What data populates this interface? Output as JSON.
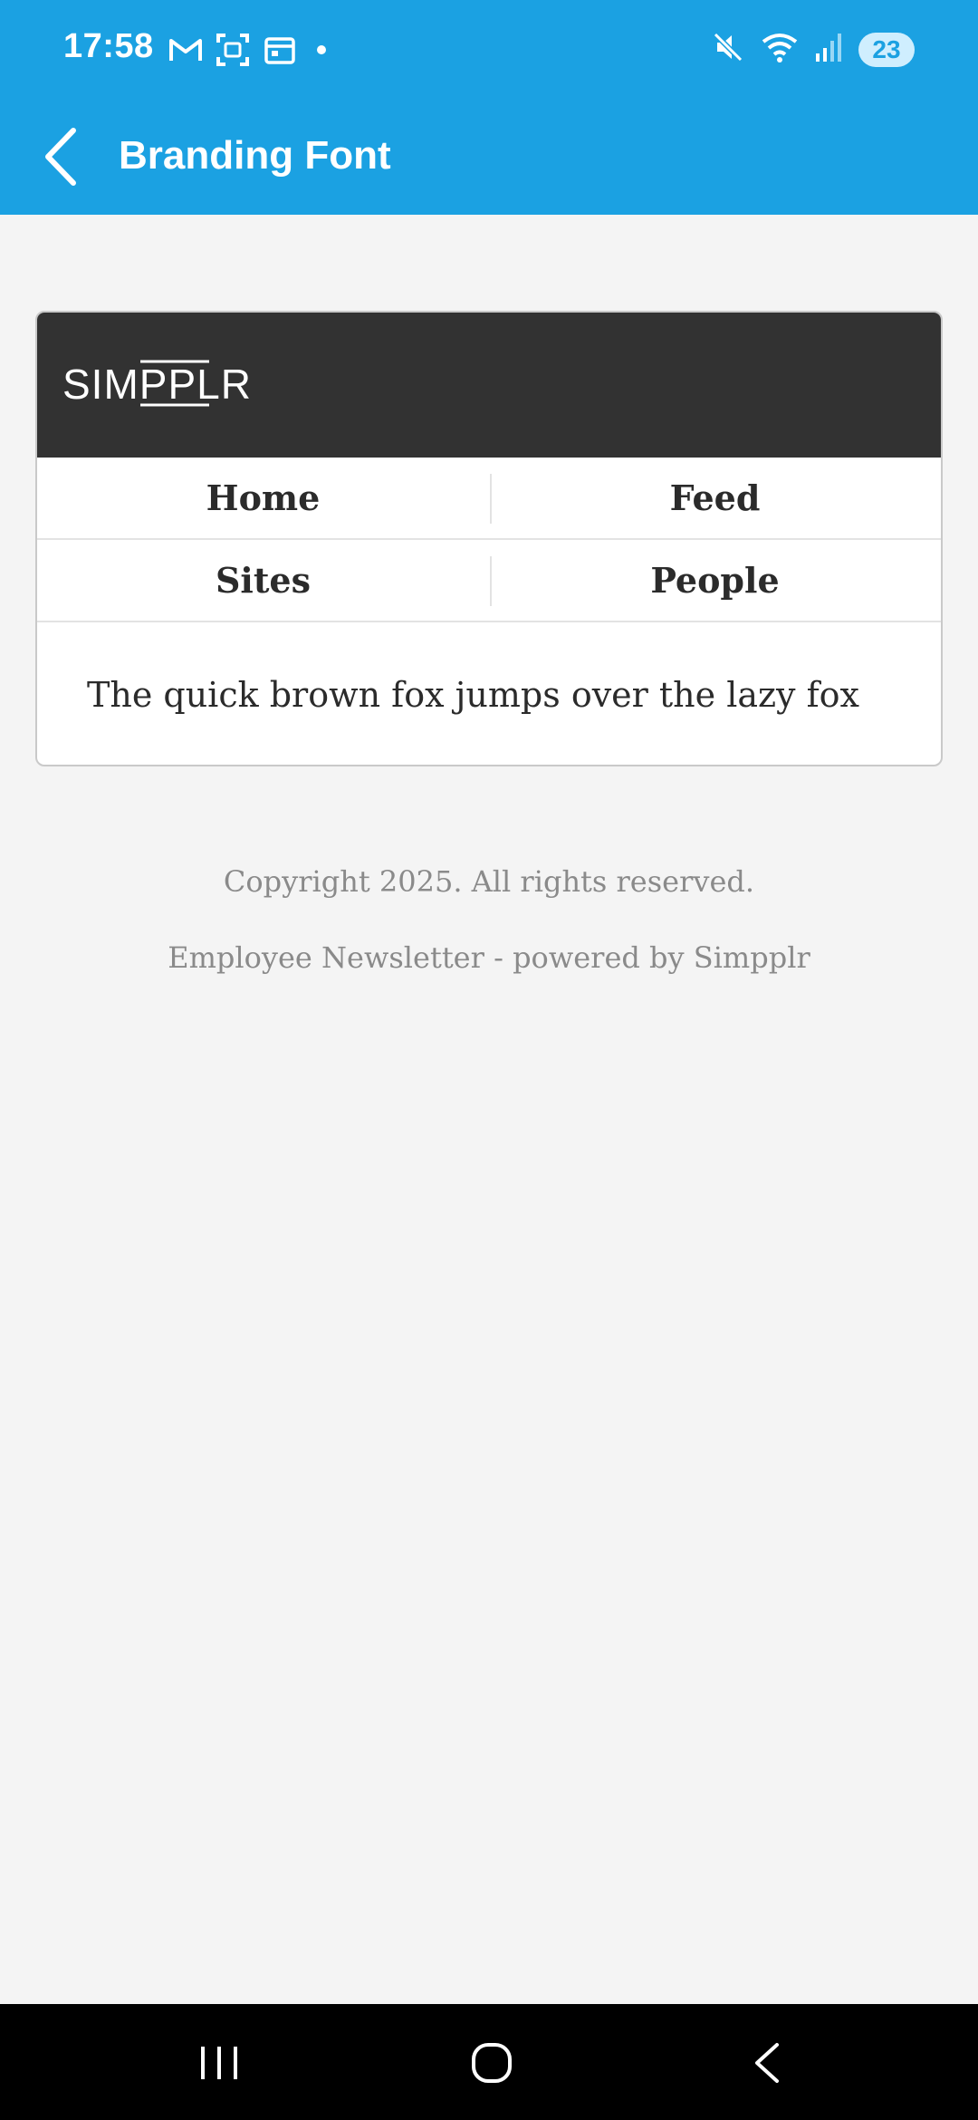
{
  "status_bar": {
    "time": "17:58",
    "left_icons": [
      "gmail-icon",
      "screenshot-icon",
      "calendar-icon",
      "notification-dot"
    ],
    "right_icons": [
      "mute-icon",
      "wifi-icon",
      "signal-icon"
    ],
    "battery": "23"
  },
  "app_bar": {
    "title": "Branding Font",
    "back_icon": "chevron-left-icon"
  },
  "preview": {
    "logo_text": "SIMPPLR",
    "nav_items": [
      "Home",
      "Feed",
      "Sites",
      "People"
    ],
    "sample_text": "The quick brown fox jumps over the lazy fox"
  },
  "footer": {
    "copyright": "Copyright 2025. All rights reserved.",
    "powered_by": "Employee Newsletter - powered by Simpplr"
  },
  "colors": {
    "app_bar": "#1ba1e2",
    "card_header": "#323232",
    "page_background": "#f4f4f4",
    "system_nav": "#000000"
  }
}
